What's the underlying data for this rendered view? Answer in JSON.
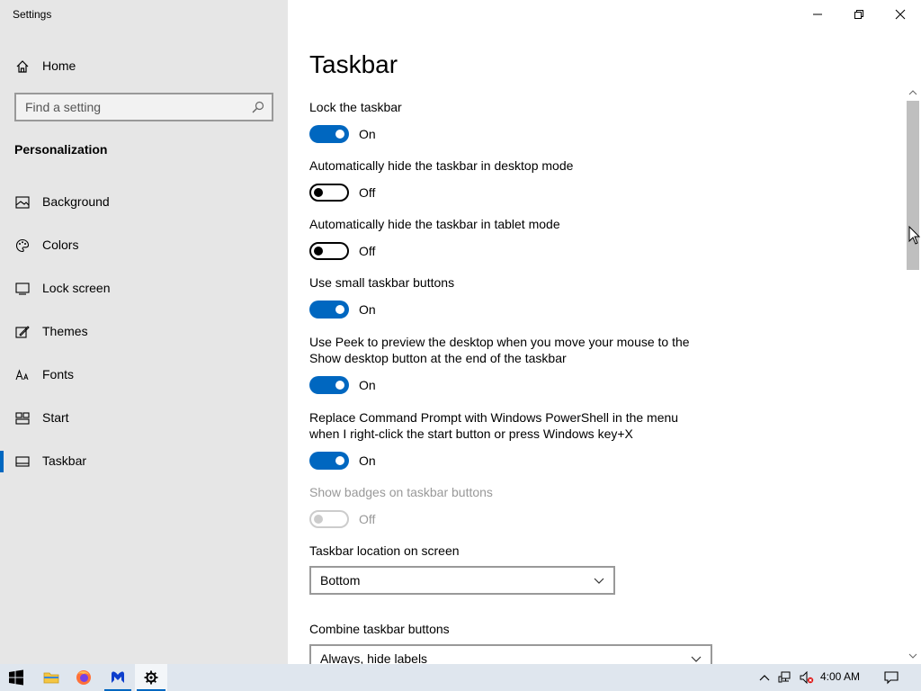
{
  "app": {
    "title": "Settings"
  },
  "sidebar": {
    "home_label": "Home",
    "search_placeholder": "Find a setting",
    "section": "Personalization",
    "items": [
      {
        "label": "Background",
        "icon": "image-icon"
      },
      {
        "label": "Colors",
        "icon": "palette-icon"
      },
      {
        "label": "Lock screen",
        "icon": "lock-screen-icon"
      },
      {
        "label": "Themes",
        "icon": "themes-icon"
      },
      {
        "label": "Fonts",
        "icon": "fonts-icon"
      },
      {
        "label": "Start",
        "icon": "start-icon"
      },
      {
        "label": "Taskbar",
        "icon": "taskbar-icon",
        "active": true
      }
    ]
  },
  "page": {
    "title": "Taskbar",
    "settings": [
      {
        "label": "Lock the taskbar",
        "state": "On"
      },
      {
        "label": "Automatically hide the taskbar in desktop mode",
        "state": "Off"
      },
      {
        "label": "Automatically hide the taskbar in tablet mode",
        "state": "Off"
      },
      {
        "label": "Use small taskbar buttons",
        "state": "On"
      },
      {
        "label": "Use Peek to preview the desktop when you move your mouse to the Show desktop button at the end of the taskbar",
        "state": "On"
      },
      {
        "label": "Replace Command Prompt with Windows PowerShell in the menu when I right-click the start button or press Windows key+X",
        "state": "On"
      },
      {
        "label": "Show badges on taskbar buttons",
        "state": "Off",
        "disabled": true
      }
    ],
    "location": {
      "label": "Taskbar location on screen",
      "value": "Bottom"
    },
    "combine": {
      "label": "Combine taskbar buttons",
      "value": "Always, hide labels"
    }
  },
  "taskbar": {
    "clock": "4:00 AM",
    "accent": "#0067c0"
  }
}
